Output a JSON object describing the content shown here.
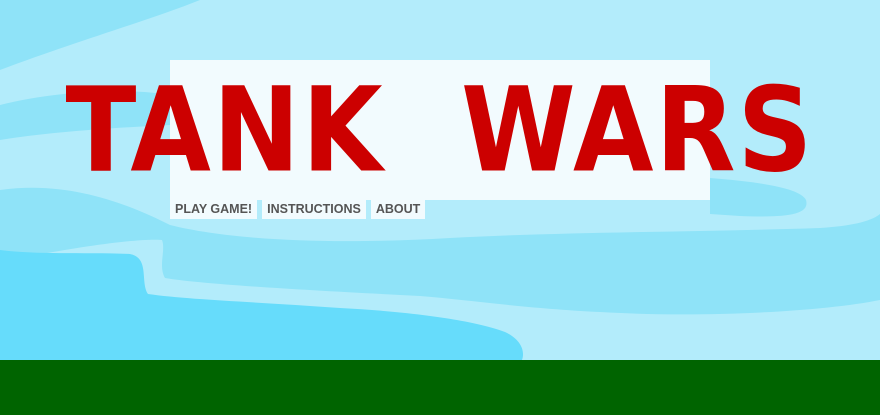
{
  "game": {
    "title": "TANK  WARS",
    "menu": [
      {
        "label": "PLAY GAME!"
      },
      {
        "label": "INSTRUCTIONS"
      },
      {
        "label": "ABOUT"
      }
    ]
  },
  "colors": {
    "sky_light": "#b3ecfb",
    "sky_mid": "#8fe3f8",
    "sky_dark": "#66dcfb",
    "ground": "#006400",
    "title_red": "#cc0000",
    "panel": "#f2fbfe",
    "menu_text": "#555555"
  }
}
